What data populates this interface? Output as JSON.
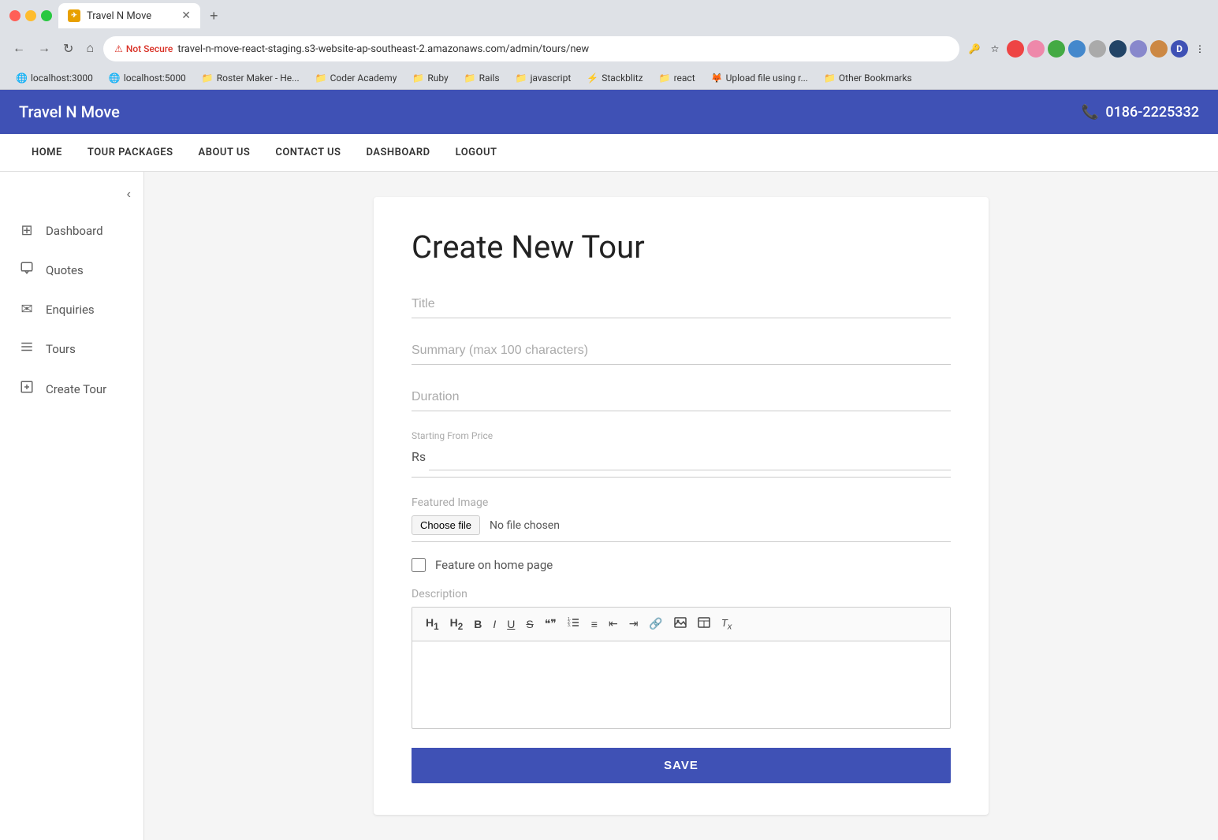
{
  "browser": {
    "tab": {
      "title": "Travel N Move",
      "icon": "✈"
    },
    "url": {
      "not_secure_label": "Not Secure",
      "address": "travel-n-move-react-staging.s3-website-ap-southeast-2.amazonaws.com/admin/tours/new"
    },
    "bookmarks": [
      {
        "label": "localhost:3000",
        "icon": "🌐"
      },
      {
        "label": "localhost:5000",
        "icon": "🌐"
      },
      {
        "label": "Roster Maker - He...",
        "icon": "📁"
      },
      {
        "label": "Coder Academy",
        "icon": "📁"
      },
      {
        "label": "Ruby",
        "icon": "📁"
      },
      {
        "label": "Rails",
        "icon": "📁"
      },
      {
        "label": "javascript",
        "icon": "📁"
      },
      {
        "label": "Stackblitz",
        "icon": "⚡"
      },
      {
        "label": "react",
        "icon": "📁"
      },
      {
        "label": "Upload file using r...",
        "icon": "🦊"
      },
      {
        "label": "Other Bookmarks",
        "icon": "📁"
      }
    ]
  },
  "app": {
    "header": {
      "title": "Travel N Move",
      "phone": "0186-2225332"
    },
    "nav": {
      "items": [
        {
          "label": "HOME"
        },
        {
          "label": "TOUR PACKAGES"
        },
        {
          "label": "ABOUT US"
        },
        {
          "label": "CONTACT US"
        },
        {
          "label": "DASHBOARD"
        },
        {
          "label": "LOGOUT"
        }
      ]
    },
    "sidebar": {
      "items": [
        {
          "label": "Dashboard",
          "icon": "⊞"
        },
        {
          "label": "Quotes",
          "icon": "💬"
        },
        {
          "label": "Enquiries",
          "icon": "✉"
        },
        {
          "label": "Tours",
          "icon": "☰"
        },
        {
          "label": "Create Tour",
          "icon": "⊞+"
        }
      ]
    },
    "form": {
      "title": "Create New Tour",
      "fields": {
        "title_placeholder": "Title",
        "summary_placeholder": "Summary (max 100 characters)",
        "duration_placeholder": "Duration",
        "price_label": "Starting From Price",
        "price_prefix": "Rs",
        "featured_image_label": "Featured Image",
        "choose_file_btn": "Choose file",
        "no_file_text": "No file chosen",
        "feature_checkbox_label": "Feature on home page",
        "description_label": "Description"
      },
      "editor_toolbar": {
        "buttons": [
          "H1",
          "H2",
          "B",
          "I",
          "U",
          "S",
          "❝",
          "≡",
          "≡",
          "⇤",
          "⇥",
          "🔗",
          "⬜",
          "⬛",
          "fx"
        ]
      },
      "save_button": "SAVE"
    }
  }
}
